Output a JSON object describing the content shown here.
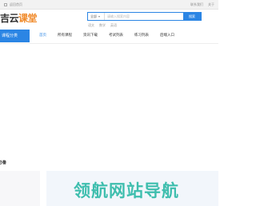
{
  "topbar": {
    "left_label": "返回首页",
    "right_links": [
      "联系我们",
      "关于"
    ]
  },
  "logo": {
    "text_main": "吉云",
    "text_accent": "课堂"
  },
  "search": {
    "select_label": "全部",
    "placeholder": "请输入搜索内容",
    "button_label": "搜索",
    "hot_words": [
      "语文",
      "数学",
      "英语"
    ]
  },
  "nav": {
    "category_label": "课程分类",
    "items": [
      {
        "label": "首页",
        "active": true
      },
      {
        "label": "所有课程"
      },
      {
        "label": "资讯下载"
      },
      {
        "label": "考试列表"
      },
      {
        "label": "练习列表"
      },
      {
        "label": "后端入口"
      }
    ]
  },
  "section": {
    "title": "必备"
  },
  "watermark": {
    "text": "领航网站导航"
  },
  "colors": {
    "accent": "#2b85e4",
    "logo_accent": "#f08a2a",
    "watermark": "#2bb8a6"
  }
}
